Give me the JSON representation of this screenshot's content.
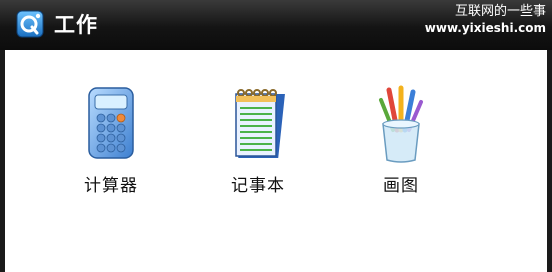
{
  "window": {
    "title": "工作",
    "logo_icon": "q-logo-icon"
  },
  "watermark": {
    "line1": "互联网的一些事",
    "line2": "www.yixieshi.com"
  },
  "apps": [
    {
      "label": "计算器",
      "icon": "calculator-icon"
    },
    {
      "label": "记事本",
      "icon": "notepad-icon"
    },
    {
      "label": "画图",
      "icon": "paint-icon"
    }
  ],
  "colors": {
    "titlebar": "#1a1a1a",
    "content_bg": "#ffffff",
    "accent": "#2f8fd6"
  }
}
